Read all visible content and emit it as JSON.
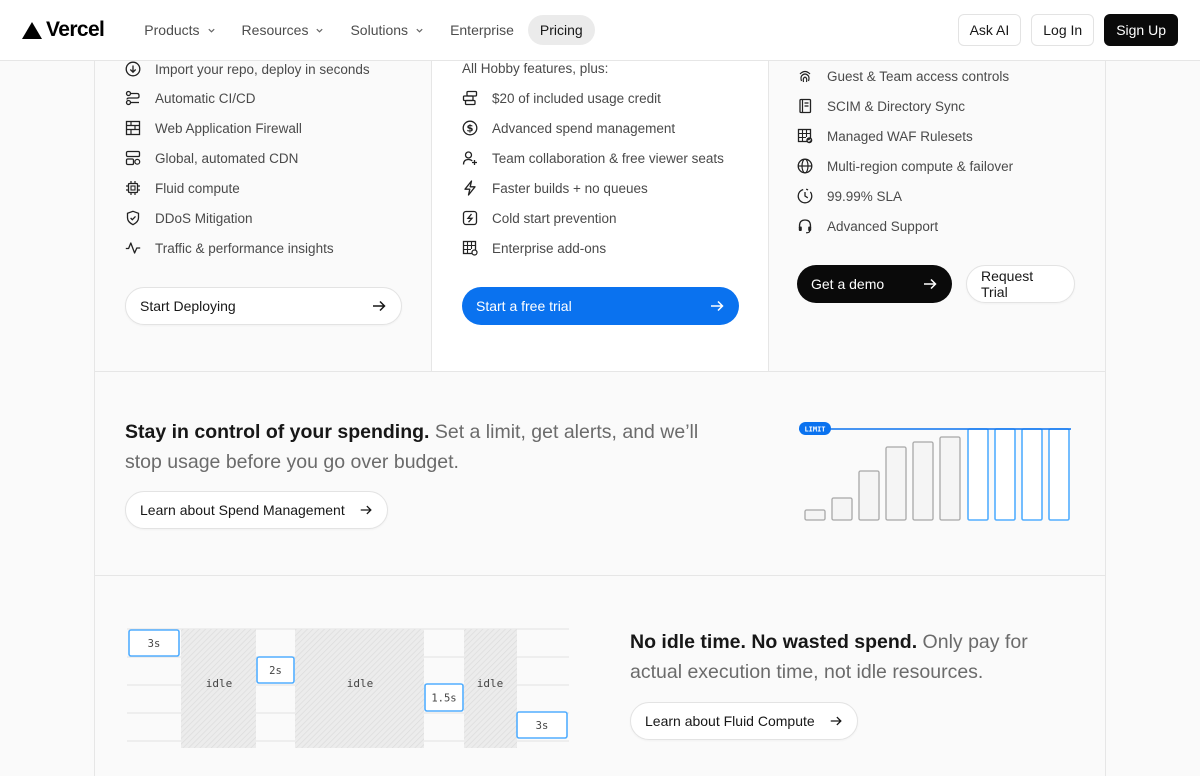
{
  "header": {
    "brand": "Vercel",
    "nav": [
      {
        "label": "Products"
      },
      {
        "label": "Resources"
      },
      {
        "label": "Solutions"
      },
      {
        "label": "Enterprise"
      },
      {
        "label": "Pricing"
      }
    ],
    "ask_ai": "Ask AI",
    "login": "Log In",
    "signup": "Sign Up"
  },
  "hobby": {
    "features": [
      "Import your repo, deploy in seconds",
      "Automatic CI/CD",
      "Web Application Firewall",
      "Global, automated CDN",
      "Fluid compute",
      "DDoS Mitigation",
      "Traffic & performance insights"
    ],
    "cta": "Start Deploying"
  },
  "pro": {
    "label": "All Hobby features, plus:",
    "features": [
      "$20 of included usage credit",
      "Advanced spend management",
      "Team collaboration & free viewer seats",
      "Faster builds + no queues",
      "Cold start prevention",
      "Enterprise add-ons"
    ],
    "cta": "Start a free trial"
  },
  "enterprise": {
    "features": [
      "Guest & Team access controls",
      "SCIM & Directory Sync",
      "Managed WAF Rulesets",
      "Multi-region compute & failover",
      "99.99% SLA",
      "Advanced Support"
    ],
    "cta_primary": "Get a demo",
    "cta_secondary": "Request Trial"
  },
  "spend": {
    "headline_bold": "Stay in control of your spending.",
    "headline_rest": " Set a limit, get alerts, and we’ll stop usage before you go over budget.",
    "link": "Learn about Spend Management",
    "chart_label": "LIMIT"
  },
  "fluid": {
    "headline_bold": "No idle time. No wasted spend.",
    "headline_rest": " Only pay for actual execution time, not idle resources.",
    "link": "Learn about Fluid Compute",
    "timeline": {
      "blocks": [
        "3s",
        "2s",
        "1.5s",
        "3s"
      ],
      "idle_labels": [
        "idle",
        "idle",
        "idle"
      ]
    }
  },
  "colors": {
    "accent_blue": "#0a72ef",
    "chart_blue": "#52aeff",
    "dark": "#0a0a0a"
  }
}
